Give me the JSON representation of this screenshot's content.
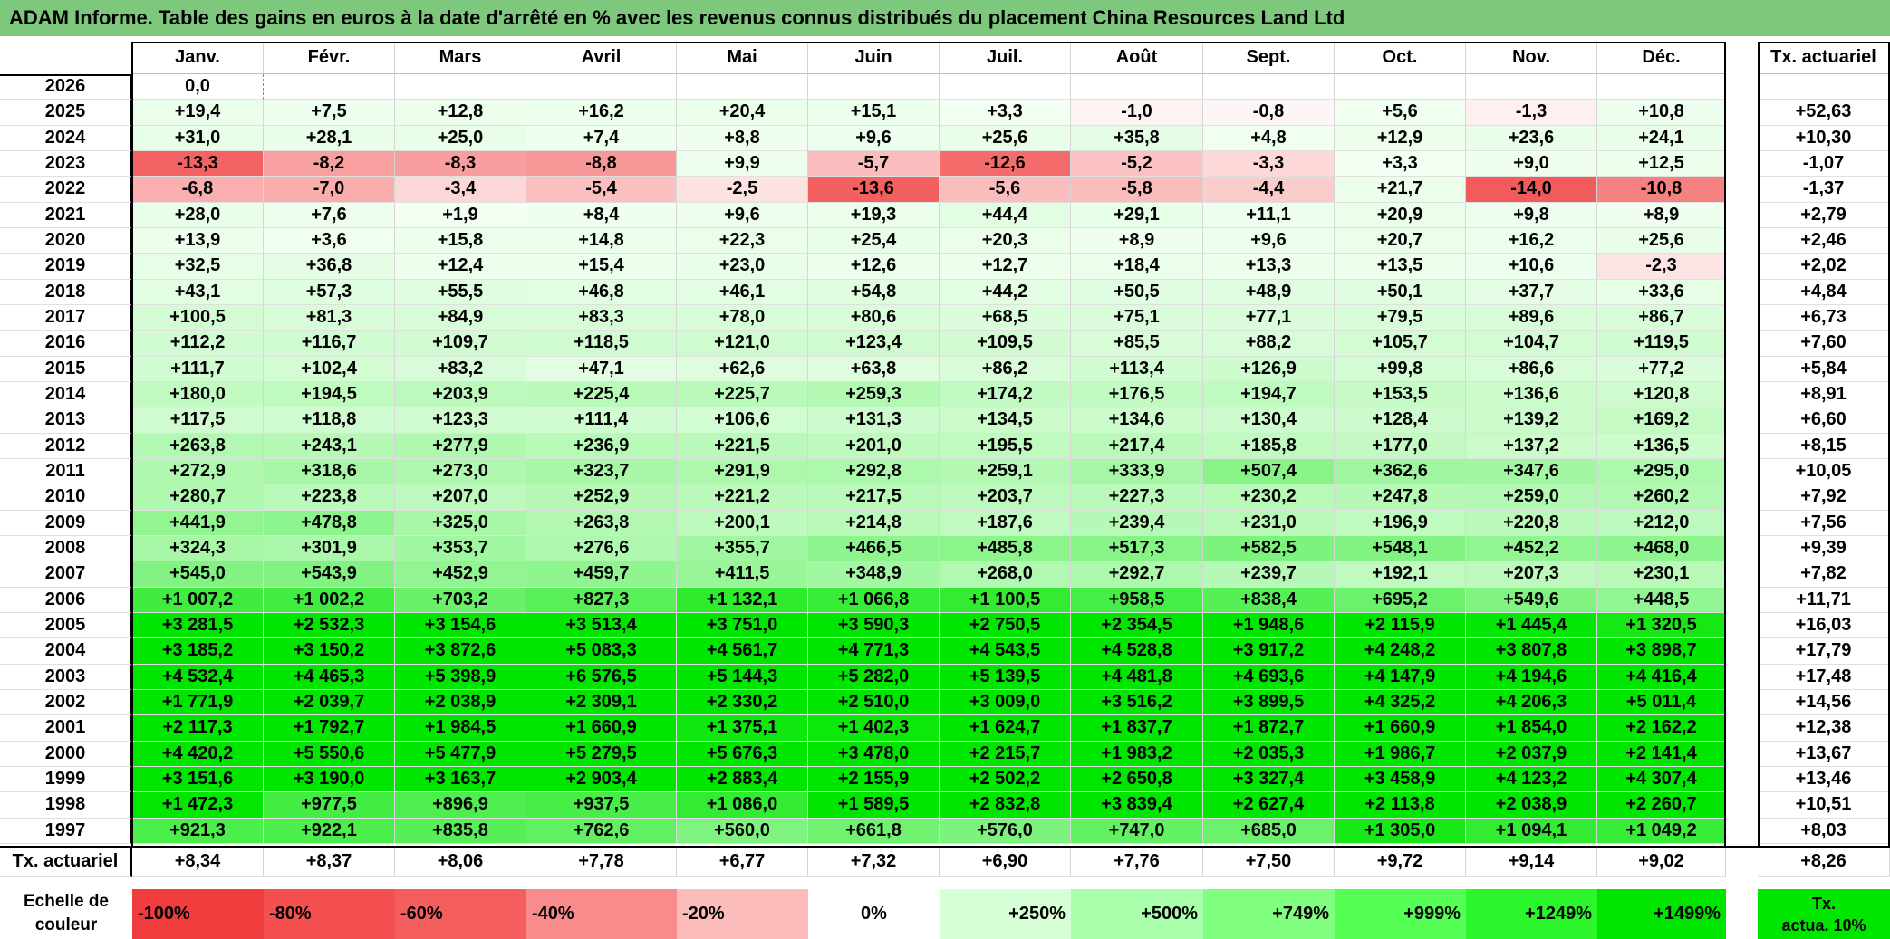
{
  "title": "ADAM Informe. Table des gains en euros à la date d'arrêté en % avec les revenus connus distribués du placement China Resources Land Ltd",
  "months": [
    "Janv.",
    "Févr.",
    "Mars",
    "Avril",
    "Mai",
    "Juin",
    "Juil.",
    "Août",
    "Sept.",
    "Oct.",
    "Nov.",
    "Déc."
  ],
  "tx_header": "Tx. actuariel",
  "rows": [
    {
      "year": "2026",
      "values": [
        "0,0",
        "",
        "",
        "",
        "",
        "",
        "",
        "",
        "",
        "",
        "",
        ""
      ],
      "tx": ""
    },
    {
      "year": "2025",
      "values": [
        "+19,4",
        "+7,5",
        "+12,8",
        "+16,2",
        "+20,4",
        "+15,1",
        "+3,3",
        "-1,0",
        "-0,8",
        "+5,6",
        "-1,3",
        "+10,8"
      ],
      "tx": "+52,63"
    },
    {
      "year": "2024",
      "values": [
        "+31,0",
        "+28,1",
        "+25,0",
        "+7,4",
        "+8,8",
        "+9,6",
        "+25,6",
        "+35,8",
        "+4,8",
        "+12,9",
        "+23,6",
        "+24,1"
      ],
      "tx": "+10,30"
    },
    {
      "year": "2023",
      "values": [
        "-13,3",
        "-8,2",
        "-8,3",
        "-8,8",
        "+9,9",
        "-5,7",
        "-12,6",
        "-5,2",
        "-3,3",
        "+3,3",
        "+9,0",
        "+12,5"
      ],
      "tx": "-1,07"
    },
    {
      "year": "2022",
      "values": [
        "-6,8",
        "-7,0",
        "-3,4",
        "-5,4",
        "-2,5",
        "-13,6",
        "-5,6",
        "-5,8",
        "-4,4",
        "+21,7",
        "-14,0",
        "-10,8"
      ],
      "tx": "-1,37"
    },
    {
      "year": "2021",
      "values": [
        "+28,0",
        "+7,6",
        "+1,9",
        "+8,4",
        "+9,6",
        "+19,3",
        "+44,4",
        "+29,1",
        "+11,1",
        "+20,9",
        "+9,8",
        "+8,9"
      ],
      "tx": "+2,79"
    },
    {
      "year": "2020",
      "values": [
        "+13,9",
        "+3,6",
        "+15,8",
        "+14,8",
        "+22,3",
        "+25,4",
        "+20,3",
        "+8,9",
        "+9,6",
        "+20,7",
        "+16,2",
        "+25,6"
      ],
      "tx": "+2,46"
    },
    {
      "year": "2019",
      "values": [
        "+32,5",
        "+36,8",
        "+12,4",
        "+15,4",
        "+23,0",
        "+12,6",
        "+12,7",
        "+18,4",
        "+13,3",
        "+13,5",
        "+10,6",
        "-2,3"
      ],
      "tx": "+2,02"
    },
    {
      "year": "2018",
      "values": [
        "+43,1",
        "+57,3",
        "+55,5",
        "+46,8",
        "+46,1",
        "+54,8",
        "+44,2",
        "+50,5",
        "+48,9",
        "+50,1",
        "+37,7",
        "+33,6"
      ],
      "tx": "+4,84"
    },
    {
      "year": "2017",
      "values": [
        "+100,5",
        "+81,3",
        "+84,9",
        "+83,3",
        "+78,0",
        "+80,6",
        "+68,5",
        "+75,1",
        "+77,1",
        "+79,5",
        "+89,6",
        "+86,7"
      ],
      "tx": "+6,73"
    },
    {
      "year": "2016",
      "values": [
        "+112,2",
        "+116,7",
        "+109,7",
        "+118,5",
        "+121,0",
        "+123,4",
        "+109,5",
        "+85,5",
        "+88,2",
        "+105,7",
        "+104,7",
        "+119,5"
      ],
      "tx": "+7,60"
    },
    {
      "year": "2015",
      "values": [
        "+111,7",
        "+102,4",
        "+83,2",
        "+47,1",
        "+62,6",
        "+63,8",
        "+86,2",
        "+113,4",
        "+126,9",
        "+99,8",
        "+86,6",
        "+77,2"
      ],
      "tx": "+5,84"
    },
    {
      "year": "2014",
      "values": [
        "+180,0",
        "+194,5",
        "+203,9",
        "+225,4",
        "+225,7",
        "+259,3",
        "+174,2",
        "+176,5",
        "+194,7",
        "+153,5",
        "+136,6",
        "+120,8"
      ],
      "tx": "+8,91"
    },
    {
      "year": "2013",
      "values": [
        "+117,5",
        "+118,8",
        "+123,3",
        "+111,4",
        "+106,6",
        "+131,3",
        "+134,5",
        "+134,6",
        "+130,4",
        "+128,4",
        "+139,2",
        "+169,2"
      ],
      "tx": "+6,60"
    },
    {
      "year": "2012",
      "values": [
        "+263,8",
        "+243,1",
        "+277,9",
        "+236,9",
        "+221,5",
        "+201,0",
        "+195,5",
        "+217,4",
        "+185,8",
        "+177,0",
        "+137,2",
        "+136,5"
      ],
      "tx": "+8,15"
    },
    {
      "year": "2011",
      "values": [
        "+272,9",
        "+318,6",
        "+273,0",
        "+323,7",
        "+291,9",
        "+292,8",
        "+259,1",
        "+333,9",
        "+507,4",
        "+362,6",
        "+347,6",
        "+295,0"
      ],
      "tx": "+10,05"
    },
    {
      "year": "2010",
      "values": [
        "+280,7",
        "+223,8",
        "+207,0",
        "+252,9",
        "+221,2",
        "+217,5",
        "+203,7",
        "+227,3",
        "+230,2",
        "+247,8",
        "+259,0",
        "+260,2"
      ],
      "tx": "+7,92"
    },
    {
      "year": "2009",
      "values": [
        "+441,9",
        "+478,8",
        "+325,0",
        "+263,8",
        "+200,1",
        "+214,8",
        "+187,6",
        "+239,4",
        "+231,0",
        "+196,9",
        "+220,8",
        "+212,0"
      ],
      "tx": "+7,56"
    },
    {
      "year": "2008",
      "values": [
        "+324,3",
        "+301,9",
        "+353,7",
        "+276,6",
        "+355,7",
        "+466,5",
        "+485,8",
        "+517,3",
        "+582,5",
        "+548,1",
        "+452,2",
        "+468,0"
      ],
      "tx": "+9,39"
    },
    {
      "year": "2007",
      "values": [
        "+545,0",
        "+543,9",
        "+452,9",
        "+459,7",
        "+411,5",
        "+348,9",
        "+268,0",
        "+292,7",
        "+239,7",
        "+192,1",
        "+207,3",
        "+230,1"
      ],
      "tx": "+7,82"
    },
    {
      "year": "2006",
      "values": [
        "+1 007,2",
        "+1 002,2",
        "+703,2",
        "+827,3",
        "+1 132,1",
        "+1 066,8",
        "+1 100,5",
        "+958,5",
        "+838,4",
        "+695,2",
        "+549,6",
        "+448,5"
      ],
      "tx": "+11,71"
    },
    {
      "year": "2005",
      "values": [
        "+3 281,5",
        "+2 532,3",
        "+3 154,6",
        "+3 513,4",
        "+3 751,0",
        "+3 590,3",
        "+2 750,5",
        "+2 354,5",
        "+1 948,6",
        "+2 115,9",
        "+1 445,4",
        "+1 320,5"
      ],
      "tx": "+16,03"
    },
    {
      "year": "2004",
      "values": [
        "+3 185,2",
        "+3 150,2",
        "+3 872,6",
        "+5 083,3",
        "+4 561,7",
        "+4 771,3",
        "+4 543,5",
        "+4 528,8",
        "+3 917,2",
        "+4 248,2",
        "+3 807,8",
        "+3 898,7"
      ],
      "tx": "+17,79"
    },
    {
      "year": "2003",
      "values": [
        "+4 532,4",
        "+4 465,3",
        "+5 398,9",
        "+6 576,5",
        "+5 144,3",
        "+5 282,0",
        "+5 139,5",
        "+4 481,8",
        "+4 693,6",
        "+4 147,9",
        "+4 194,6",
        "+4 416,4"
      ],
      "tx": "+17,48"
    },
    {
      "year": "2002",
      "values": [
        "+1 771,9",
        "+2 039,7",
        "+2 038,9",
        "+2 309,1",
        "+2 330,2",
        "+2 510,0",
        "+3 009,0",
        "+3 516,2",
        "+3 899,5",
        "+4 325,2",
        "+4 206,3",
        "+5 011,4"
      ],
      "tx": "+14,56"
    },
    {
      "year": "2001",
      "values": [
        "+2 117,3",
        "+1 792,7",
        "+1 984,5",
        "+1 660,9",
        "+1 375,1",
        "+1 402,3",
        "+1 624,7",
        "+1 837,7",
        "+1 872,7",
        "+1 660,9",
        "+1 854,0",
        "+2 162,2"
      ],
      "tx": "+12,38"
    },
    {
      "year": "2000",
      "values": [
        "+4 420,2",
        "+5 550,6",
        "+5 477,9",
        "+5 279,5",
        "+5 676,3",
        "+3 478,0",
        "+2 215,7",
        "+1 983,2",
        "+2 035,3",
        "+1 986,7",
        "+2 037,9",
        "+2 141,4"
      ],
      "tx": "+13,67"
    },
    {
      "year": "1999",
      "values": [
        "+3 151,6",
        "+3 190,0",
        "+3 163,7",
        "+2 903,4",
        "+2 883,4",
        "+2 155,9",
        "+2 502,2",
        "+2 650,8",
        "+3 327,4",
        "+3 458,9",
        "+4 123,2",
        "+4 307,4"
      ],
      "tx": "+13,46"
    },
    {
      "year": "1998",
      "values": [
        "+1 472,3",
        "+977,5",
        "+896,9",
        "+937,5",
        "+1 086,0",
        "+1 589,5",
        "+2 832,8",
        "+3 839,4",
        "+2 627,4",
        "+2 113,8",
        "+2 038,9",
        "+2 260,7"
      ],
      "tx": "+10,51"
    },
    {
      "year": "1997",
      "values": [
        "+921,3",
        "+922,1",
        "+835,8",
        "+762,6",
        "+560,0",
        "+661,8",
        "+576,0",
        "+747,0",
        "+685,0",
        "+1 305,0",
        "+1 094,1",
        "+1 049,2"
      ],
      "tx": "+8,03"
    }
  ],
  "footer": {
    "label": "Tx. actuariel",
    "values": [
      "+8,34",
      "+8,37",
      "+8,06",
      "+7,78",
      "+6,77",
      "+7,32",
      "+6,90",
      "+7,76",
      "+7,50",
      "+9,72",
      "+9,14",
      "+9,02"
    ],
    "tx": "+8,26"
  },
  "scale": {
    "label_line1": "Echelle de",
    "label_line2": "couleur",
    "items": [
      {
        "text": "-100%",
        "color": "#f03c3c",
        "align": "left"
      },
      {
        "text": "-80%",
        "color": "#f45050",
        "align": "left"
      },
      {
        "text": "-60%",
        "color": "#f55e5e",
        "align": "left"
      },
      {
        "text": "-40%",
        "color": "#f88c8c",
        "align": "left"
      },
      {
        "text": "-20%",
        "color": "#fcbcbc",
        "align": "left"
      },
      {
        "text": "0%",
        "color": "#ffffff",
        "align": "center"
      },
      {
        "text": "+250%",
        "color": "#d6ffd6",
        "align": "right"
      },
      {
        "text": "+500%",
        "color": "#aaffaa",
        "align": "right"
      },
      {
        "text": "+749%",
        "color": "#80ff80",
        "align": "right"
      },
      {
        "text": "+999%",
        "color": "#55ff55",
        "align": "right"
      },
      {
        "text": "+1249%",
        "color": "#2bf52b",
        "align": "right"
      },
      {
        "text": "+1499%",
        "color": "#00e600",
        "align": "right"
      }
    ],
    "tx_line1": "Tx.",
    "tx_line2": "actua. 10%"
  }
}
